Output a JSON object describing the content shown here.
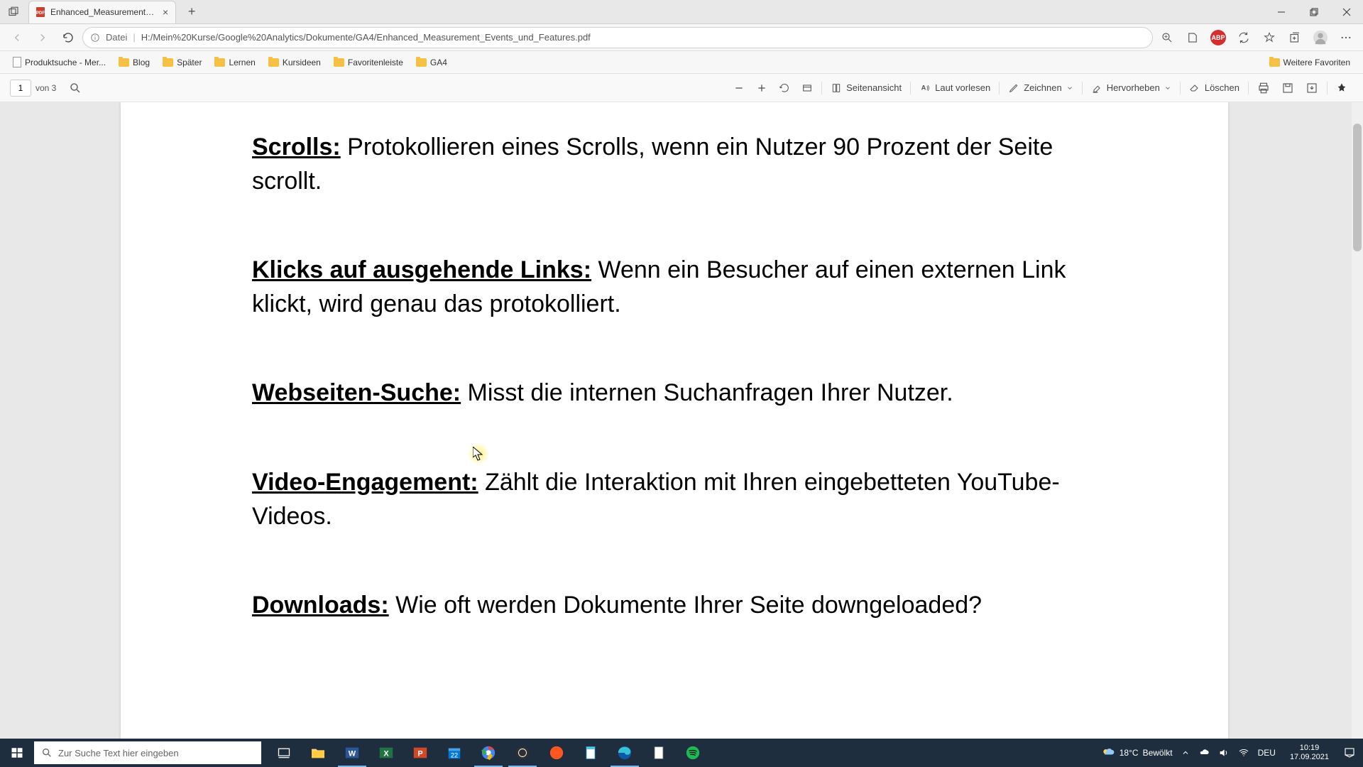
{
  "tab": {
    "title": "Enhanced_Measurement_Events"
  },
  "url": {
    "prefix": "Datei",
    "path": "H:/Mein%20Kurse/Google%20Analytics/Dokumente/GA4/Enhanced_Measurement_Events_und_Features.pdf"
  },
  "bookmarks": [
    {
      "type": "doc",
      "label": "Produktsuche - Mer..."
    },
    {
      "type": "folder",
      "label": "Blog"
    },
    {
      "type": "folder",
      "label": "Später"
    },
    {
      "type": "folder",
      "label": "Lernen"
    },
    {
      "type": "folder",
      "label": "Kursideen"
    },
    {
      "type": "folder",
      "label": "Favoritenleiste"
    },
    {
      "type": "folder",
      "label": "GA4"
    }
  ],
  "more_favorites": "Weitere Favoriten",
  "page": {
    "current": "1",
    "total_label": "von 3"
  },
  "pdf_tools": {
    "page_view": "Seitenansicht",
    "read_aloud": "Laut vorlesen",
    "draw": "Zeichnen",
    "highlight": "Hervorheben",
    "erase": "Löschen"
  },
  "doc": {
    "entries": [
      {
        "title": "Scrolls:",
        "body": " Protokollieren eines Scrolls, wenn ein Nutzer 90 Prozent der Seite scrollt."
      },
      {
        "title": "Klicks auf ausgehende Links:",
        "body": " Wenn ein Besucher auf einen externen Link klickt, wird genau das protokolliert."
      },
      {
        "title": "Webseiten-Suche:",
        "body": " Misst die internen Suchanfragen Ihrer Nutzer."
      },
      {
        "title": "Video-Engagement:",
        "body": " Zählt die Interaktion mit Ihren eingebetteten YouTube-Videos."
      },
      {
        "title": "Downloads:",
        "body": " Wie oft werden Dokumente Ihrer Seite downgeloaded?"
      }
    ]
  },
  "taskbar": {
    "search_placeholder": "Zur Suche Text hier eingeben",
    "weather_temp": "18°C",
    "weather_label": "Bewölkt",
    "lang": "DEU",
    "time": "10:19",
    "date": "17.09.2021"
  }
}
